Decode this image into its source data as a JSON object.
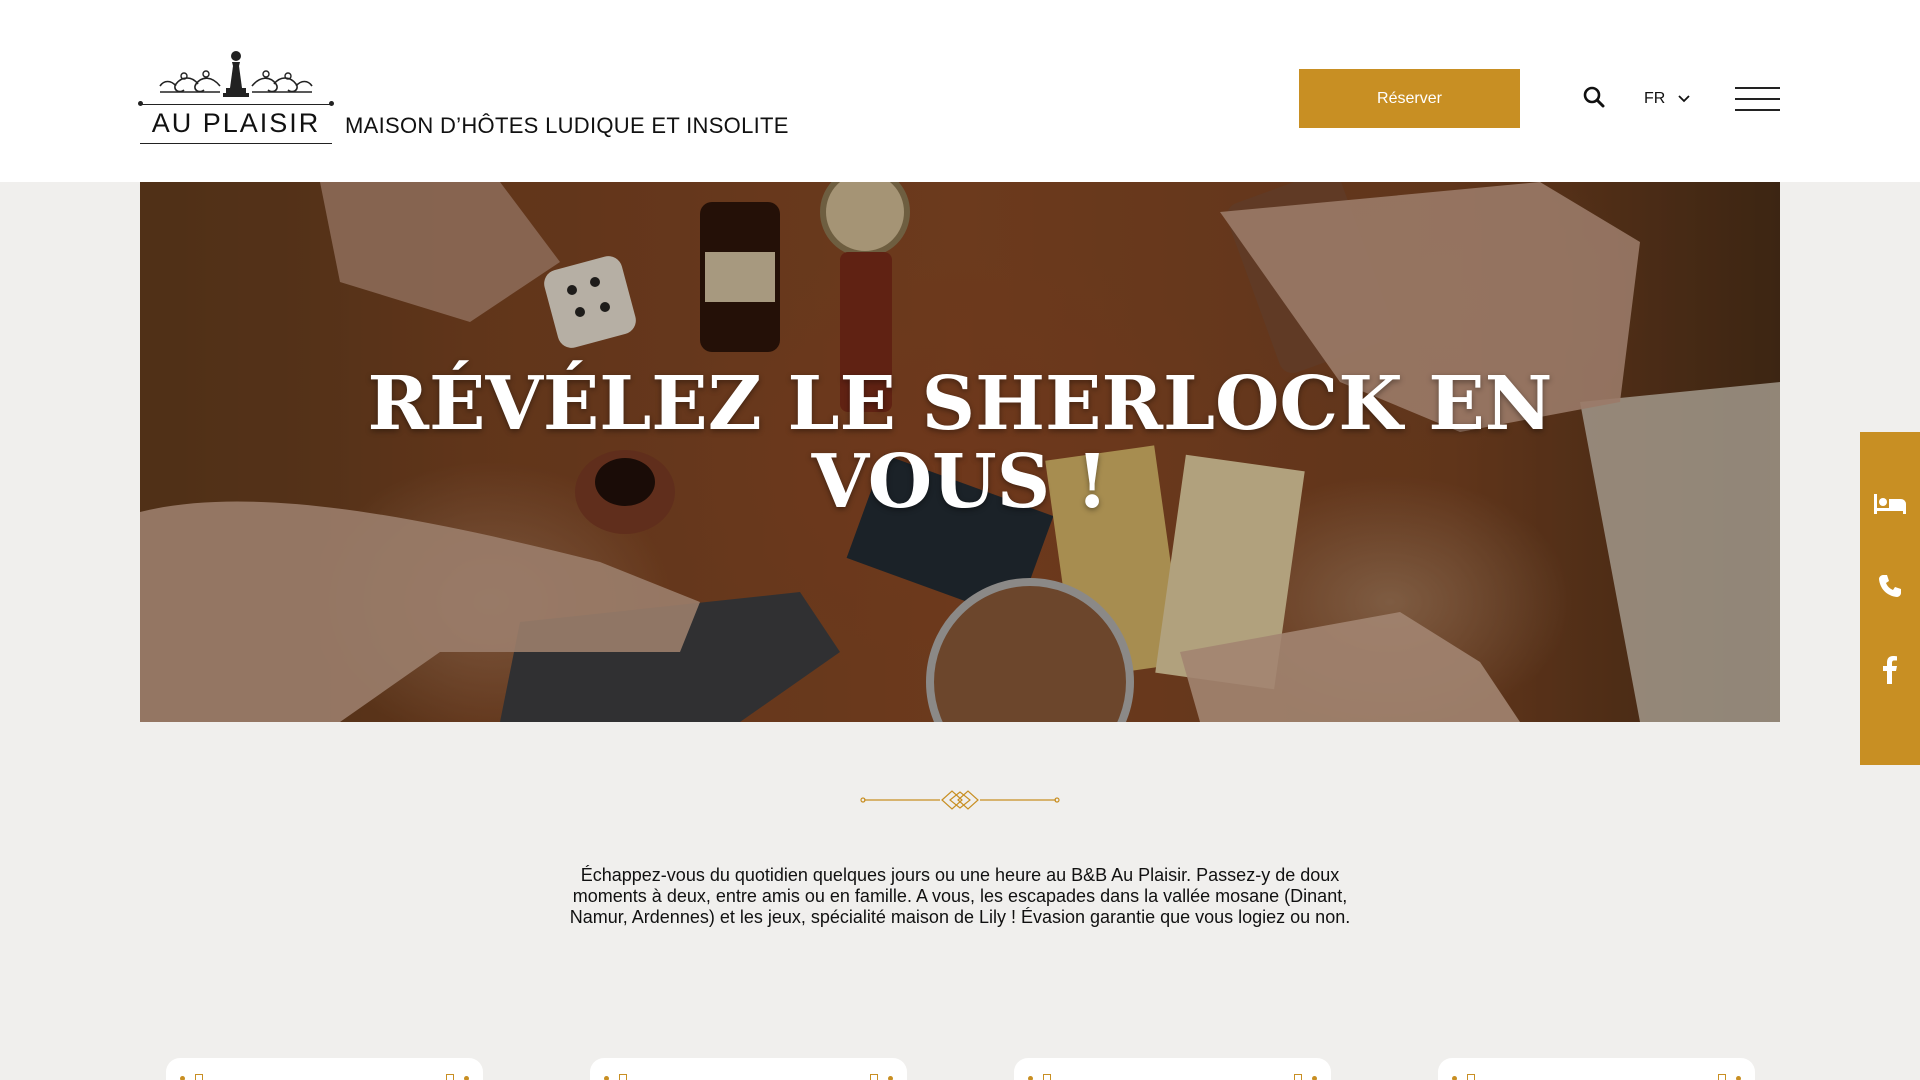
{
  "header": {
    "logo_text": "AU PLAISIR",
    "tagline": "MAISON D’HÔTES LUDIQUE ET INSOLITE",
    "reserve_label": "Réserver",
    "language": "FR"
  },
  "hero": {
    "title_line1": "RÉVÉLEZ LE SHERLOCK EN",
    "title_line2": "VOUS !"
  },
  "intro": {
    "line1": "Échappez-vous du quotidien quelques jours ou une heure au B&B Au Plaisir. Passez-y de doux",
    "line2": "moments à deux, entre amis ou en famille. A vous, les escapades dans la vallée mosane (Dinant,",
    "line3": "Namur, Ardennes) et les jeux, spécialité maison de Lily ! Évasion garantie que vous logiez ou non."
  },
  "side_bar": {
    "icons": [
      "bed-icon",
      "phone-icon",
      "facebook-icon"
    ]
  },
  "colors": {
    "accent": "#c88f23",
    "background": "#f0efed",
    "header_bg": "#ffffff"
  }
}
